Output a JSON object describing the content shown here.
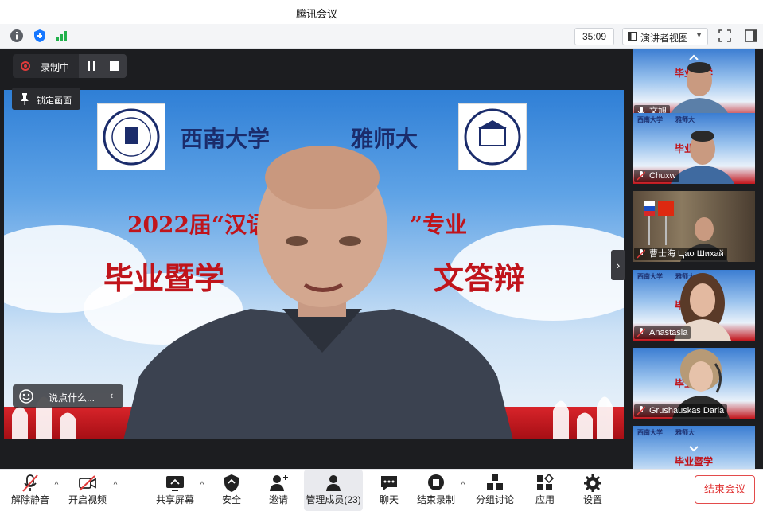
{
  "window": {
    "title": "腾讯会议"
  },
  "infobar": {
    "timer": "35:09",
    "view_label": "演讲者视图"
  },
  "recording": {
    "label": "录制中"
  },
  "lock_view": {
    "label": "锁定画面"
  },
  "chat": {
    "placeholder": "说点什么..."
  },
  "banner": {
    "left_name": "西南大学",
    "right_name": "雅师大",
    "line1": "2022届“汉语",
    "line1_tail": "”专业",
    "line2": "毕业暨学",
    "line2_tail": "文答辩"
  },
  "participants": [
    {
      "name": "文旭",
      "muted": false
    },
    {
      "name": "Chuxw",
      "muted": true
    },
    {
      "name": "曹士海 Цао Шихай",
      "muted": true
    },
    {
      "name": "Anastasia",
      "muted": true
    },
    {
      "name": "Grushauskas Daria",
      "muted": true
    },
    {
      "name": "",
      "muted": true
    }
  ],
  "toolbar": {
    "unmute": "解除静音",
    "video": "开启视频",
    "share": "共享屏幕",
    "security": "安全",
    "invite": "邀请",
    "members": "管理成员(23)",
    "chat": "聊天",
    "stop_record": "结束录制",
    "breakout": "分组讨论",
    "apps": "应用",
    "settings": "设置",
    "end": "结束会议"
  },
  "colors": {
    "accent_red": "#e03131",
    "panel_dark": "#1c1d20",
    "banner_red": "#c0141b",
    "banner_blue": "#1b2c6b"
  }
}
